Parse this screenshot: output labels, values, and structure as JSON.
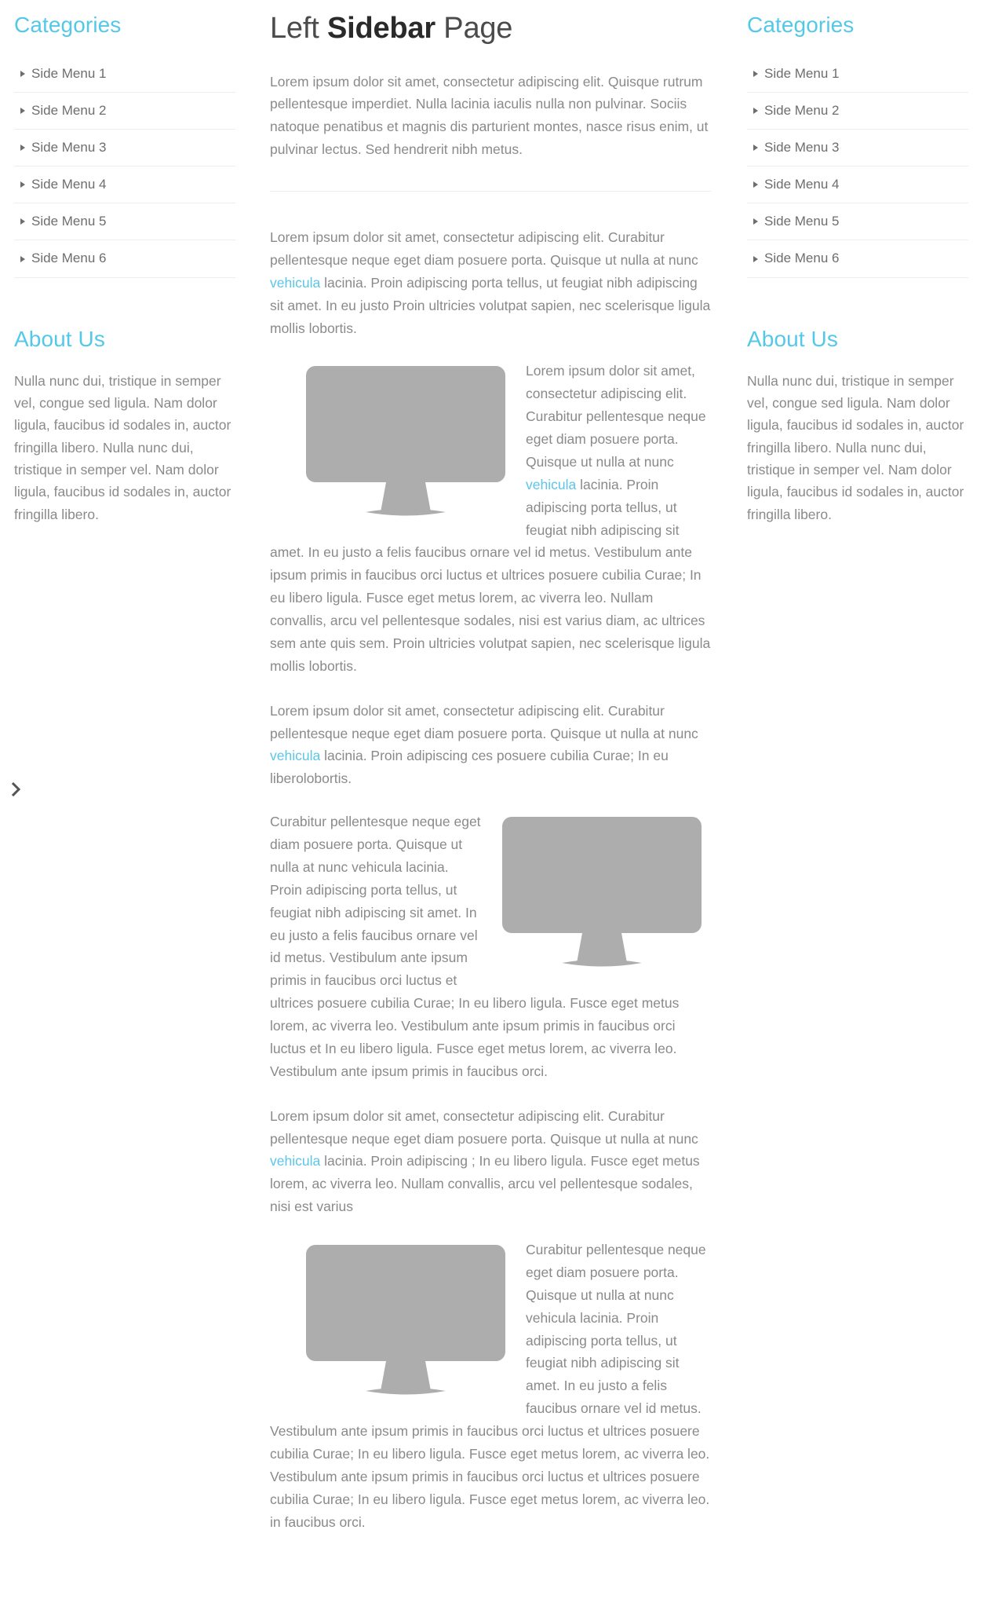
{
  "colors": {
    "accent": "#54c8e8",
    "link": "#5bc6e8",
    "body_text": "#8a8a8a",
    "heading": "#2a2a2a",
    "placeholder_gray": "#adadad",
    "divider": "#ededea"
  },
  "edge_toggle": {
    "icon": "chevron-right-icon",
    "glyph": "❯"
  },
  "sidebar_left": {
    "categories": {
      "title": "Categories",
      "items": [
        {
          "label": "Side Menu 1"
        },
        {
          "label": "Side Menu 2"
        },
        {
          "label": "Side Menu 3"
        },
        {
          "label": "Side Menu 4"
        },
        {
          "label": "Side Menu 5"
        },
        {
          "label": "Side Menu 6"
        }
      ]
    },
    "about": {
      "title": "About Us",
      "text": "Nulla nunc dui, tristique in semper vel, congue sed ligula. Nam dolor ligula, faucibus id sodales in, auctor fringilla libero. Nulla nunc dui, tristique in semper vel. Nam dolor ligula, faucibus id sodales in, auctor fringilla libero."
    }
  },
  "sidebar_right": {
    "categories": {
      "title": "Categories",
      "items": [
        {
          "label": "Side Menu 1"
        },
        {
          "label": "Side Menu 2"
        },
        {
          "label": "Side Menu 3"
        },
        {
          "label": "Side Menu 4"
        },
        {
          "label": "Side Menu 5"
        },
        {
          "label": "Side Menu 6"
        }
      ]
    },
    "about": {
      "title": "About Us",
      "text": "Nulla nunc dui, tristique in semper vel, congue sed ligula. Nam dolor ligula, faucibus id sodales in, auctor fringilla libero. Nulla nunc dui, tristique in semper vel. Nam dolor ligula, faucibus id sodales in, auctor fringilla libero."
    }
  },
  "main": {
    "title_part1": "Left ",
    "title_bold": "Sidebar",
    "title_part2": " Page",
    "intro_paragraph": "Lorem ipsum dolor sit amet, consectetur adipiscing elit. Quisque rutrum pellentesque imperdiet. Nulla lacinia iaculis nulla non pulvinar. Sociis natoque penatibus et magnis dis parturient montes, nasce risus enim, ut pulvinar lectus. Sed hendrerit nibh metus.",
    "paragraph2_before_link": "Lorem ipsum dolor sit amet, consectetur adipiscing elit. Curabitur pellentesque neque eget diam posuere porta. Quisque ut nulla at nunc ",
    "paragraph2_link": "vehicula",
    "paragraph2_after_link": " lacinia. Proin adipiscing porta tellus, ut feugiat nibh adipiscing sit amet. In eu justo  Proin ultricies volutpat sapien, nec scelerisque ligula mollis lobortis.",
    "figure1": {
      "image_alt": "monitor-placeholder",
      "text_before_link": "Lorem ipsum dolor sit amet, consectetur adipiscing elit. Curabitur pellentesque neque eget diam posuere porta. Quisque ut nulla at nunc ",
      "link": "vehicula",
      "text_after_link": " lacinia. Proin adipiscing porta tellus, ut feugiat nibh adipiscing sit amet. In eu justo a felis faucibus ornare vel id metus. Vestibulum ante ipsum primis in faucibus orci luctus et ultrices posuere cubilia Curae; In eu libero ligula. Fusce eget metus lorem, ac viverra leo. Nullam convallis, arcu vel pellentesque sodales, nisi est varius diam, ac ultrices sem ante quis sem. Proin ultricies volutpat sapien, nec scelerisque ligula mollis lobortis."
    },
    "paragraph3_before_link": "Lorem ipsum dolor sit amet, consectetur adipiscing elit. Curabitur pellentesque neque eget diam posuere porta. Quisque ut nulla at nunc ",
    "paragraph3_link": "vehicula",
    "paragraph3_after_link": " lacinia. Proin adipiscing ces posuere cubilia Curae; In eu liberolobortis.",
    "figure2": {
      "image_alt": "monitor-placeholder",
      "text": "Curabitur pellentesque neque eget diam posuere porta. Quisque ut nulla at nunc vehicula lacinia. Proin adipiscing porta tellus, ut feugiat nibh adipiscing sit amet. In eu justo a felis faucibus ornare vel id metus. Vestibulum ante ipsum primis in faucibus orci luctus et ultrices posuere cubilia Curae; In eu libero ligula. Fusce eget metus lorem, ac viverra leo. Vestibulum ante ipsum primis in faucibus orci luctus et In eu libero ligula. Fusce eget metus lorem, ac viverra leo. Vestibulum ante ipsum primis in faucibus orci."
    },
    "paragraph4_before_link": "Lorem ipsum dolor sit amet, consectetur adipiscing elit. Curabitur pellentesque neque eget diam posuere porta. Quisque ut nulla at nunc ",
    "paragraph4_link": "vehicula",
    "paragraph4_after_link": " lacinia. Proin adipiscing ; In eu libero ligula. Fusce eget metus lorem, ac viverra leo. Nullam convallis, arcu vel pellentesque sodales, nisi est varius",
    "figure3": {
      "image_alt": "monitor-placeholder",
      "text": "Curabitur pellentesque neque eget diam posuere porta. Quisque ut nulla at nunc vehicula lacinia. Proin adipiscing porta tellus, ut feugiat nibh adipiscing sit amet. In eu justo a felis faucibus ornare vel id metus. Vestibulum ante ipsum primis in faucibus orci luctus et ultrices posuere cubilia Curae; In eu libero ligula. Fusce eget metus lorem, ac viverra leo. Vestibulum ante ipsum primis in faucibus orci luctus et ultrices posuere cubilia Curae; In eu libero ligula. Fusce eget metus lorem, ac viverra leo. in faucibus orci."
    }
  }
}
